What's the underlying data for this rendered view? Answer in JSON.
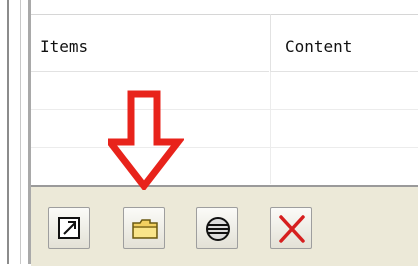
{
  "table": {
    "columns": [
      "Items",
      "Content"
    ]
  },
  "toolbar": {
    "buttons": [
      {
        "name": "open-external-button",
        "icon": "open-external-icon"
      },
      {
        "name": "open-folder-button",
        "icon": "folder-icon"
      },
      {
        "name": "globe-button",
        "icon": "globe-icon"
      },
      {
        "name": "delete-button",
        "icon": "red-x-icon"
      }
    ]
  },
  "annotation": {
    "icon": "down-arrow-icon",
    "color": "#e8231b"
  }
}
